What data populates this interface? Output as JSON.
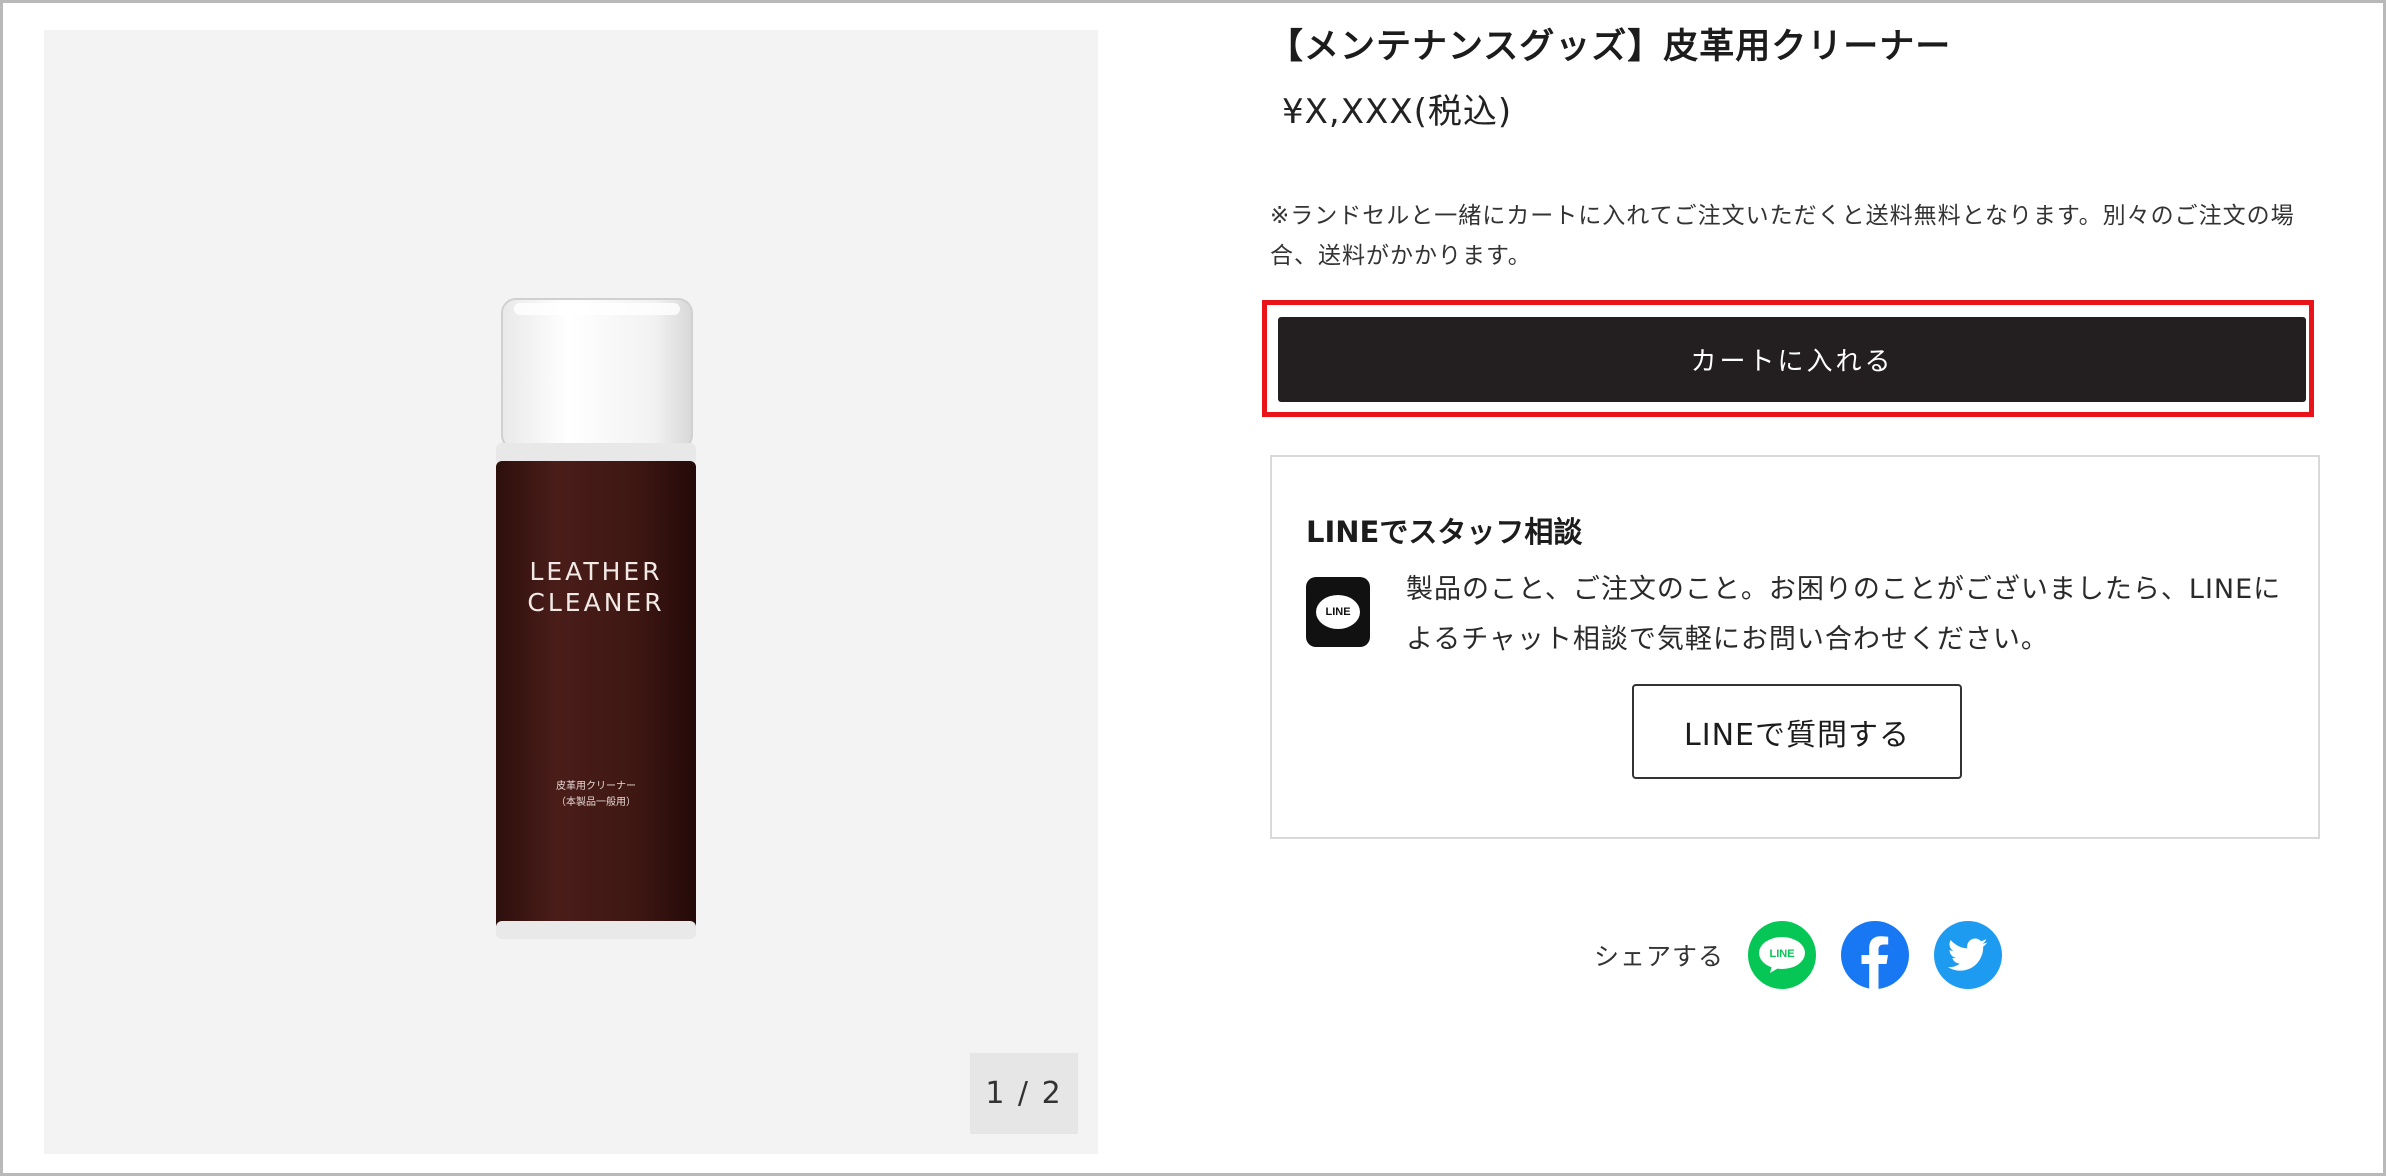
{
  "product": {
    "title": "【メンテナンスグッズ】皮革用クリーナー",
    "price": "¥X,XXX(税込)",
    "shipping_note": "※ランドセルと一緒にカートに入れてご注文いただくと送料無料となります。別々のご注文の場合、送料がかかります。",
    "image_label_line1": "LEATHER",
    "image_label_line2": "CLEANER",
    "image_small_line1": "皮革用クリーナー",
    "image_small_line2": "（本製品一般用）"
  },
  "gallery": {
    "counter": "1 / 2"
  },
  "cart": {
    "button_label": "カートに入れる",
    "highlight_color": "#e8141a"
  },
  "line_consult": {
    "heading": "LINEでスタッフ相談",
    "logo_text": "LINE",
    "description": "製品のこと、ご注文のこと。お困りのことがございましたら、LINEによるチャット相談で気軽にお問い合わせください。",
    "button_label": "LINEで質問する"
  },
  "share": {
    "label": "シェアする",
    "icons": [
      {
        "name": "line-share-icon",
        "text": "LINE",
        "color": "#06c755"
      },
      {
        "name": "facebook-share-icon",
        "color": "#1877f2"
      },
      {
        "name": "twitter-share-icon",
        "color": "#1d9bf0"
      }
    ]
  }
}
